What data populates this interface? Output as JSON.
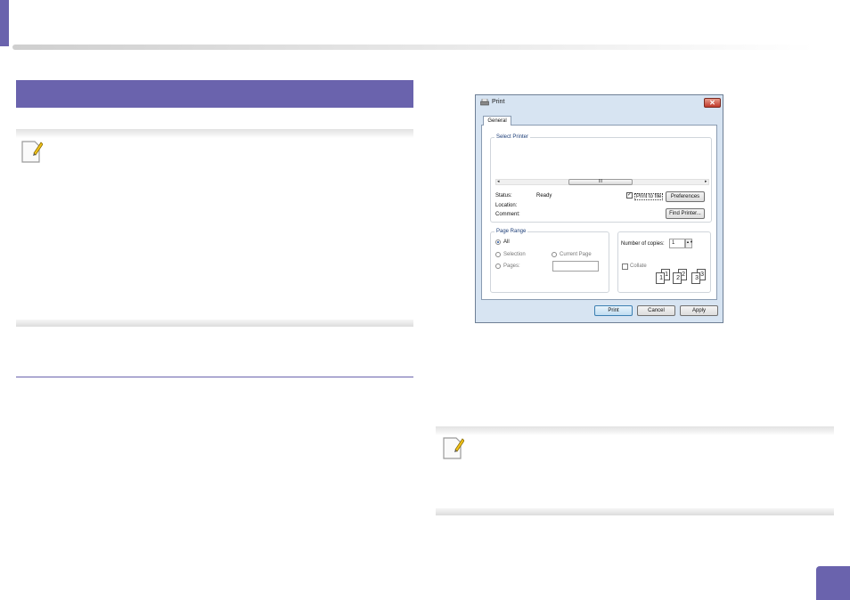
{
  "page": {
    "number": ""
  },
  "print_dialog": {
    "title": "Print",
    "close_glyph": "✕",
    "tab": "General",
    "select_printer": {
      "title": "Select Printer",
      "scroll_left": "◂",
      "scroll_right": "▸",
      "scroll_thumb": "III",
      "status_label": "Status:",
      "status_value": "Ready",
      "location_label": "Location:",
      "comment_label": "Comment:",
      "print_to_file_label": "Print to file",
      "print_to_file_check": "✓",
      "preferences_button": "Preferences",
      "find_printer_button": "Find Printer..."
    },
    "page_range": {
      "title": "Page Range",
      "all": "All",
      "selection": "Selection",
      "current_page": "Current Page",
      "pages": "Pages:"
    },
    "copies": {
      "number_label": "Number of copies:",
      "value": "1",
      "spin_glyph": "▲▼",
      "collate_label": "Collate",
      "collate_pages": [
        "1",
        "1",
        "2",
        "2",
        "3",
        "3"
      ]
    },
    "buttons": {
      "print": "Print",
      "cancel": "Cancel",
      "apply": "Apply"
    }
  },
  "colors": {
    "accent": "#6a63ad",
    "dialog_frame": "#d7e4f2"
  },
  "icons": [
    "note-pencil-icon",
    "printer-icon",
    "close-icon"
  ]
}
